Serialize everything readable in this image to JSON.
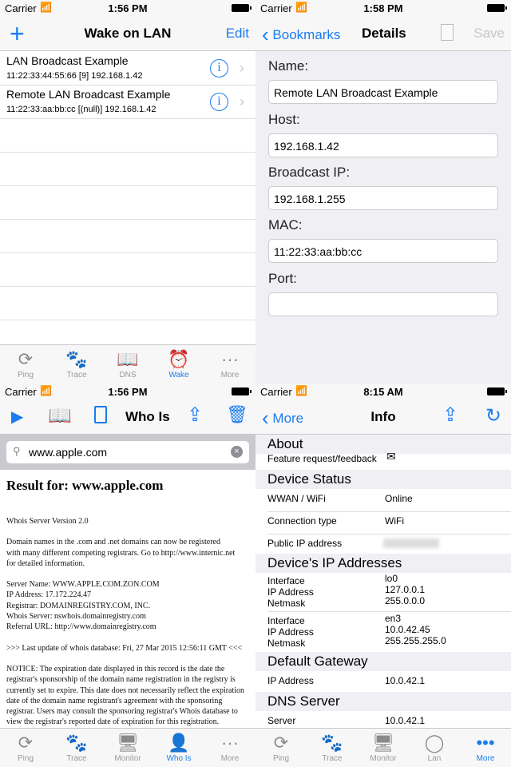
{
  "colors": {
    "accent": "#1a7cf0",
    "bar": "#f7f7f7",
    "group": "#efeff4"
  },
  "wol": {
    "status": {
      "carrier": "Carrier",
      "time": "1:56 PM"
    },
    "title": "Wake on LAN",
    "add_icon": "plus-icon",
    "edit": "Edit",
    "items": [
      {
        "name": "LAN Broadcast Example",
        "detail": "11:22:33:44:55:66 [9]   192.168.1.42"
      },
      {
        "name": "Remote LAN Broadcast Example",
        "detail": "11:22:33:aa:bb:cc [(null)]   192.168.1.42"
      }
    ]
  },
  "tabs1": [
    {
      "label": "Ping",
      "icon": "refresh-arrows-icon"
    },
    {
      "label": "Trace",
      "icon": "paw-icon"
    },
    {
      "label": "DNS",
      "icon": "book-icon"
    },
    {
      "label": "Wake",
      "icon": "alarm-clock-icon"
    },
    {
      "label": "More",
      "icon": "more-dots-icon"
    }
  ],
  "details": {
    "status": {
      "carrier": "Carrier",
      "time": "1:58 PM"
    },
    "back": "Bookmarks",
    "title": "Details",
    "save": "Save",
    "fields": [
      {
        "label": "Name:",
        "value": "Remote LAN Broadcast Example"
      },
      {
        "label": "Host:",
        "value": "192.168.1.42"
      },
      {
        "label": "Broadcast IP:",
        "value": "192.168.1.255"
      },
      {
        "label": "MAC:",
        "value": "11:22:33:aa:bb:cc"
      },
      {
        "label": "Port:",
        "value": ""
      }
    ]
  },
  "whois": {
    "status": {
      "carrier": "Carrier",
      "time": "1:56 PM"
    },
    "title": "Who Is",
    "search": "www.apple.com",
    "heading": "Result for: www.apple.com",
    "paragraphs": [
      "Whois Server Version 2.0",
      "Domain names in the .com and .net domains can now be registered\nwith many different competing registrars. Go to http://www.internic.net\nfor detailed information.",
      "Server Name: WWW.APPLE.COM.ZON.COM\nIP Address: 17.172.224.47\nRegistrar: DOMAINREGISTRY.COM, INC.\nWhois Server: nswhois.domainregistry.com\nReferral URL: http://www.domainregistry.com",
      ">>> Last update of whois database: Fri, 27 Mar 2015 12:56:11 GMT <<<",
      "NOTICE: The expiration date displayed in this record is the date the registrar's sponsorship of the domain name registration in the registry is currently set to expire. This date does not necessarily reflect the expiration date of the domain name registrant's agreement with the sponsoring registrar. Users may consult the sponsoring registrar's Whois database to view the registrar's reported date of expiration for this registration."
    ]
  },
  "tabs3": [
    {
      "label": "Ping",
      "icon": "refresh-arrows-icon"
    },
    {
      "label": "Trace",
      "icon": "paw-icon"
    },
    {
      "label": "Monitor",
      "icon": "monitor-icon"
    },
    {
      "label": "Who Is",
      "icon": "person-icon"
    },
    {
      "label": "More",
      "icon": "more-dots-icon"
    }
  ],
  "info": {
    "status": {
      "carrier": "Carrier",
      "time": "8:15 AM"
    },
    "back": "More",
    "title": "Info",
    "about": "About",
    "feedback": "Feature request/feedback",
    "device_status": "Device Status",
    "wwan_l": "WWAN / WiFi",
    "wwan_v": "Online",
    "conn_l": "Connection type",
    "conn_v": "WiFi",
    "pub_l": "Public IP address",
    "ip_title": "Device's IP Addresses",
    "if_l": "Interface",
    "ip_l": "IP Address",
    "nm_l": "Netmask",
    "ifs": [
      {
        "iface": "lo0",
        "ip": "127.0.0.1",
        "mask": "255.0.0.0"
      },
      {
        "iface": "en3",
        "ip": "10.0.42.45",
        "mask": "255.255.255.0"
      }
    ],
    "gw_title": "Default Gateway",
    "gw_l": "IP Address",
    "gw_v": "10.0.42.1",
    "dns_title": "DNS Server",
    "dns_l": "Server",
    "dns_v": "10.0.42.1"
  },
  "tabs4": [
    {
      "label": "Ping",
      "icon": "refresh-arrows-icon"
    },
    {
      "label": "Trace",
      "icon": "paw-icon"
    },
    {
      "label": "Monitor",
      "icon": "monitor-icon"
    },
    {
      "label": "Lan",
      "icon": "lan-icon"
    },
    {
      "label": "More",
      "icon": "more-dots-icon"
    }
  ]
}
